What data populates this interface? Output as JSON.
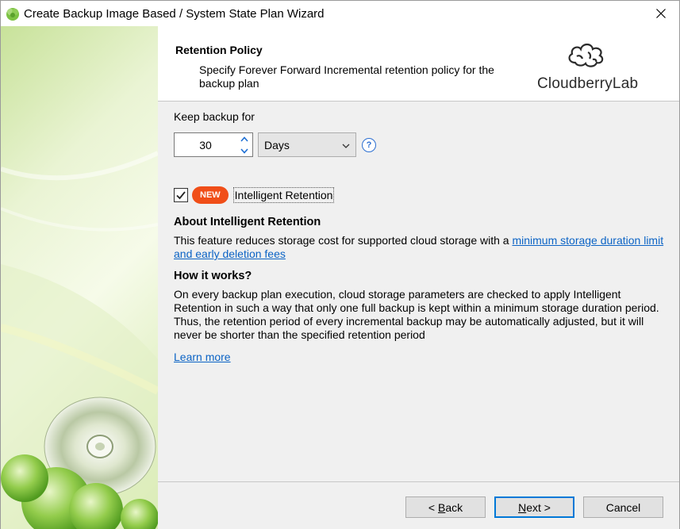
{
  "window": {
    "title": "Create Backup Image Based / System State Plan Wizard",
    "icons": {
      "app": "cloudberry-app-icon",
      "close": "close-icon"
    }
  },
  "header": {
    "title": "Retention Policy",
    "description": "Specify Forever Forward Incremental retention policy for the backup plan",
    "logo_text": "CloudberryLab"
  },
  "retention": {
    "keep_label": "Keep backup for",
    "value": "30",
    "unit": "Days",
    "unit_icon": "chevron-down-icon",
    "help_icon": "?"
  },
  "intelligent_retention": {
    "checked": true,
    "badge": "NEW",
    "label": "Intelligent Retention",
    "badge_color": "#f04e18"
  },
  "about": {
    "title": "About Intelligent Retention",
    "text": "This feature reduces storage cost for supported cloud storage with a",
    "link": "minimum storage duration limit and early deletion fees"
  },
  "how": {
    "title": "How it works?",
    "text": "On every backup plan execution, cloud storage parameters are checked to apply Intelligent Retention in such a way that only one full backup is kept within a minimum storage duration period. Thus, the retention period of every incremental backup may be automatically adjusted, but it will never be shorter than the specified retention period"
  },
  "learn_more": "Learn more",
  "buttons": {
    "back_prefix": "< ",
    "back_key": "B",
    "back_rest": "ack",
    "next_key": "N",
    "next_rest": "ext >",
    "cancel": "Cancel"
  },
  "colors": {
    "link": "#0b63c5",
    "accent": "#0078d7",
    "side_panel": "#cfe6a0"
  }
}
